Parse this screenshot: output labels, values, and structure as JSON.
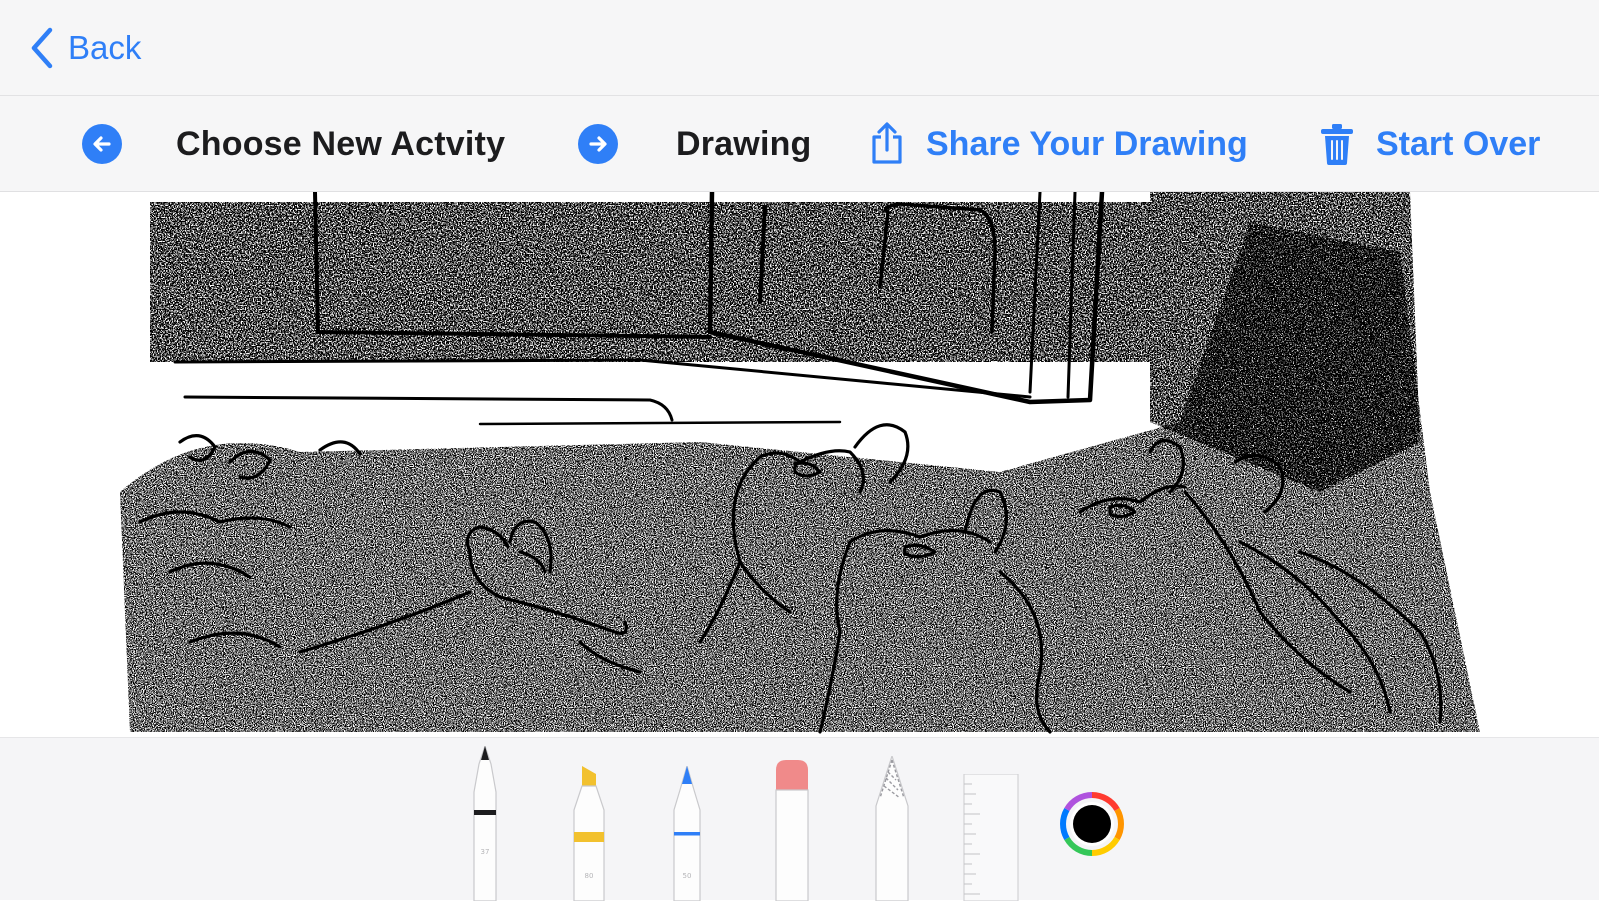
{
  "nav": {
    "back_label": "Back"
  },
  "toolbar": {
    "choose_label": "Choose New Actvity",
    "activity_label": "Drawing",
    "share_label": "Share Your Drawing",
    "start_over_label": "Start Over"
  },
  "canvas": {
    "subject": "line-art sketch of squirrels by a window"
  },
  "tools": [
    {
      "name": "pen",
      "selected": true
    },
    {
      "name": "marker"
    },
    {
      "name": "pencil"
    },
    {
      "name": "eraser"
    },
    {
      "name": "lasso"
    },
    {
      "name": "ruler"
    },
    {
      "name": "color-picker",
      "current_color": "#000000"
    }
  ],
  "colors": {
    "accent": "#2f7ff7",
    "bar_bg": "#f6f6f7",
    "text_dark": "#1c1c1e"
  },
  "icons": [
    "chevron-left-icon",
    "arrow-left-circle-icon",
    "arrow-right-circle-icon",
    "share-icon",
    "trash-icon"
  ]
}
